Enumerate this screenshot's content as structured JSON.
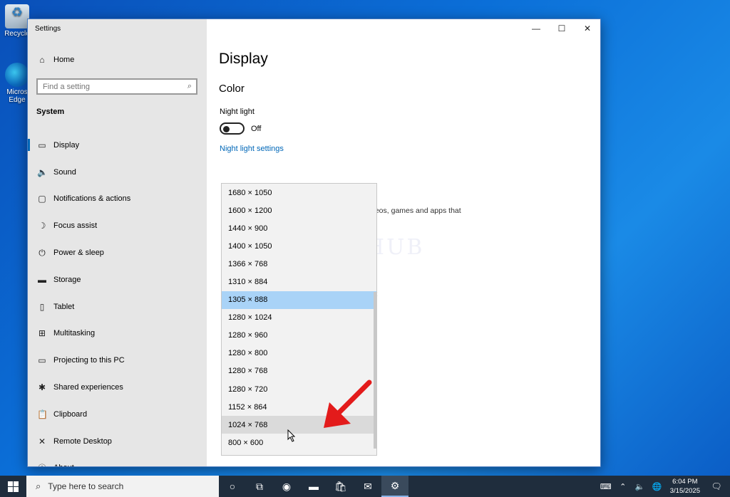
{
  "desktop": {
    "icons": [
      {
        "label": "Recycle",
        "icon": "recycle-bin-icon"
      },
      {
        "label": "Micros Edge",
        "icon": "edge-icon"
      }
    ]
  },
  "window": {
    "app_title": "Settings",
    "controls": {
      "minimize": "—",
      "maximize": "☐",
      "close": "✕"
    }
  },
  "sidebar": {
    "home": "Home",
    "search_placeholder": "Find a setting",
    "group_title": "System",
    "items": [
      {
        "label": "Display",
        "icon": "monitor-icon",
        "glyph": "▭"
      },
      {
        "label": "Sound",
        "icon": "speaker-icon",
        "glyph": "🔈"
      },
      {
        "label": "Notifications & actions",
        "icon": "message-icon",
        "glyph": "▢"
      },
      {
        "label": "Focus assist",
        "icon": "moon-icon",
        "glyph": "☽"
      },
      {
        "label": "Power & sleep",
        "icon": "power-icon",
        "glyph": "⏻"
      },
      {
        "label": "Storage",
        "icon": "storage-icon",
        "glyph": "▬"
      },
      {
        "label": "Tablet",
        "icon": "tablet-icon",
        "glyph": "▯"
      },
      {
        "label": "Multitasking",
        "icon": "multitask-icon",
        "glyph": "⊞"
      },
      {
        "label": "Projecting to this PC",
        "icon": "project-icon",
        "glyph": "▭"
      },
      {
        "label": "Shared experiences",
        "icon": "share-icon",
        "glyph": "✱"
      },
      {
        "label": "Clipboard",
        "icon": "clipboard-icon",
        "glyph": "📋"
      },
      {
        "label": "Remote Desktop",
        "icon": "remote-icon",
        "glyph": "✕"
      },
      {
        "label": "About",
        "icon": "info-icon",
        "glyph": "ⓘ"
      }
    ]
  },
  "content": {
    "title": "Display",
    "section": "Color",
    "night_light_label": "Night light",
    "night_light_state": "Off",
    "night_light_link": "Night light settings",
    "behind_text": "deos, games and apps that",
    "watermark": "IT Pros HUB",
    "stray_char": ":"
  },
  "resolution_dropdown": {
    "options": [
      "1680 × 1050",
      "1600 × 1200",
      "1440 × 900",
      "1400 × 1050",
      "1366 × 768",
      "1310 × 884",
      "1305 × 888",
      "1280 × 1024",
      "1280 × 960",
      "1280 × 800",
      "1280 × 768",
      "1280 × 720",
      "1152 × 864",
      "1024 × 768",
      "800 × 600"
    ],
    "selected": "1305 × 888",
    "hovered": "1024 × 768"
  },
  "taskbar": {
    "search_placeholder": "Type here to search",
    "apps": [
      {
        "icon": "cortana-icon",
        "glyph": "○"
      },
      {
        "icon": "task-view-icon",
        "glyph": "⧉"
      },
      {
        "icon": "edge-icon",
        "glyph": "◉"
      },
      {
        "icon": "file-explorer-icon",
        "glyph": "▬"
      },
      {
        "icon": "store-icon",
        "glyph": "🛍"
      },
      {
        "icon": "mail-icon",
        "glyph": "✉"
      },
      {
        "icon": "settings-icon",
        "glyph": "⚙"
      }
    ],
    "time": "6:04 PM",
    "date": "3/15/2025"
  },
  "colors": {
    "accent": "#0067b8",
    "selected": "#a9d3f7",
    "arrow": "#e31b1b"
  }
}
